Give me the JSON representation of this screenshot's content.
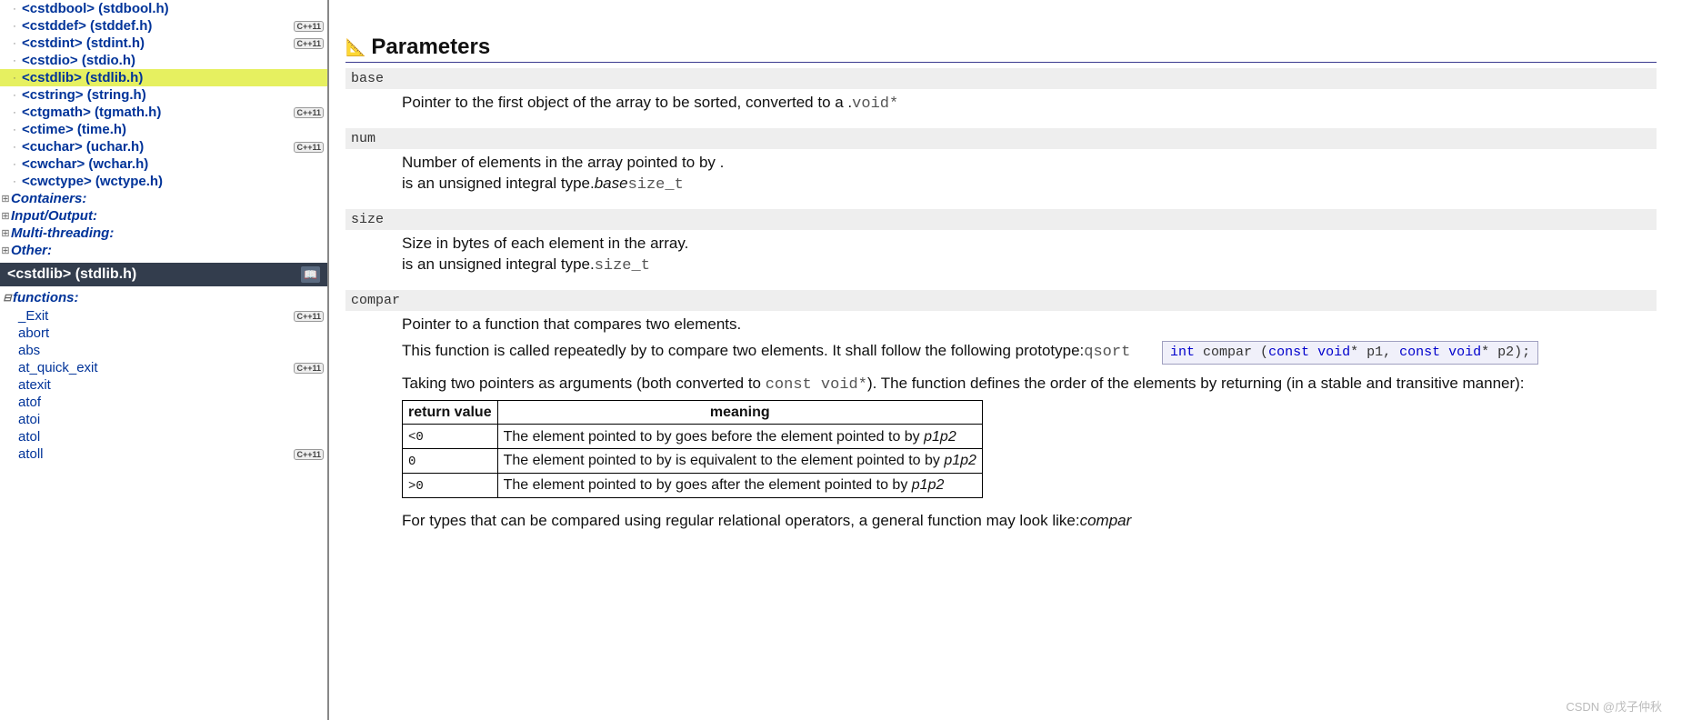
{
  "sidebar": {
    "headers": [
      {
        "label": "<cstdbool> (stdbool.h)",
        "badge": "",
        "selected": false,
        "partial": true
      },
      {
        "label": "<cstddef> (stddef.h)",
        "badge": "C++11",
        "selected": false
      },
      {
        "label": "<cstdint> (stdint.h)",
        "badge": "C++11",
        "selected": false
      },
      {
        "label": "<cstdio> (stdio.h)",
        "badge": "",
        "selected": false
      },
      {
        "label": "<cstdlib> (stdlib.h)",
        "badge": "",
        "selected": true
      },
      {
        "label": "<cstring> (string.h)",
        "badge": "",
        "selected": false
      },
      {
        "label": "<ctgmath> (tgmath.h)",
        "badge": "C++11",
        "selected": false
      },
      {
        "label": "<ctime> (time.h)",
        "badge": "",
        "selected": false
      },
      {
        "label": "<cuchar> (uchar.h)",
        "badge": "C++11",
        "selected": false
      },
      {
        "label": "<cwchar> (wchar.h)",
        "badge": "",
        "selected": false
      },
      {
        "label": "<cwctype> (wctype.h)",
        "badge": "",
        "selected": false
      }
    ],
    "categories": [
      {
        "label": "Containers:"
      },
      {
        "label": "Input/Output:"
      },
      {
        "label": "Multi-threading:"
      },
      {
        "label": "Other:"
      }
    ],
    "subheader": "<cstdlib> (stdlib.h)",
    "functions_label": "functions:",
    "functions": [
      {
        "label": "_Exit",
        "badge": "C++11"
      },
      {
        "label": "abort",
        "badge": ""
      },
      {
        "label": "abs",
        "badge": ""
      },
      {
        "label": "at_quick_exit",
        "badge": "C++11"
      },
      {
        "label": "atexit",
        "badge": ""
      },
      {
        "label": "atof",
        "badge": ""
      },
      {
        "label": "atoi",
        "badge": ""
      },
      {
        "label": "atol",
        "badge": ""
      },
      {
        "label": "atoll",
        "badge": "C++11"
      }
    ]
  },
  "main": {
    "section_title": "Parameters",
    "params": {
      "base": {
        "name": "base",
        "desc_pre": "Pointer to the first object of the array to be sorted, converted to a .",
        "desc_mono": "void*"
      },
      "num": {
        "name": "num",
        "l1": "Number of elements in the array pointed to by .",
        "l2_pre": " is an unsigned integral type.",
        "l2_ital": "base",
        "l2_mono": "size_t"
      },
      "size": {
        "name": "size",
        "l1": "Size in bytes of each element in the array.",
        "l2_pre": " is an unsigned integral type.",
        "l2_mono": "size_t"
      },
      "compar": {
        "name": "compar",
        "l1": "Pointer to a function that compares two elements.",
        "l2": "This function is called repeatedly by  to compare two elements. It shall follow the following prototype:",
        "l2_mono": "qsort",
        "proto_kw1": "int",
        "proto_p1": " compar (",
        "proto_kw2": "const",
        "proto_p2": " ",
        "proto_kw3": "void",
        "proto_p3": "* p1, ",
        "proto_kw4": "const",
        "proto_p4": " ",
        "proto_kw5": "void",
        "proto_p5": "* p2);",
        "after1_pre": "Taking two pointers as arguments (both converted to ",
        "after1_mono": "const void*",
        "after1_post": "). The function defines the order of the elements by returning (in a stable and transitive manner):",
        "table": {
          "h1": "return value",
          "h2": "meaning",
          "r1c1": "<0",
          "r1c2_pre": "The element pointed to by  goes before the element pointed to by ",
          "r1c2_ital": "p1p2",
          "r2c1": "0",
          "r2c2_pre": "The element pointed to by  is equivalent to the element pointed to by ",
          "r2c2_ital": "p1p2",
          "r3c1": ">0",
          "r3c2_pre": "The element pointed to by  goes after the element pointed to by ",
          "r3c2_ital": "p1p2"
        },
        "after2_pre": "For types that can be compared using regular relational operators, a general function may look like:",
        "after2_ital": "compar"
      }
    },
    "watermark": "CSDN @戊子仲秋"
  }
}
